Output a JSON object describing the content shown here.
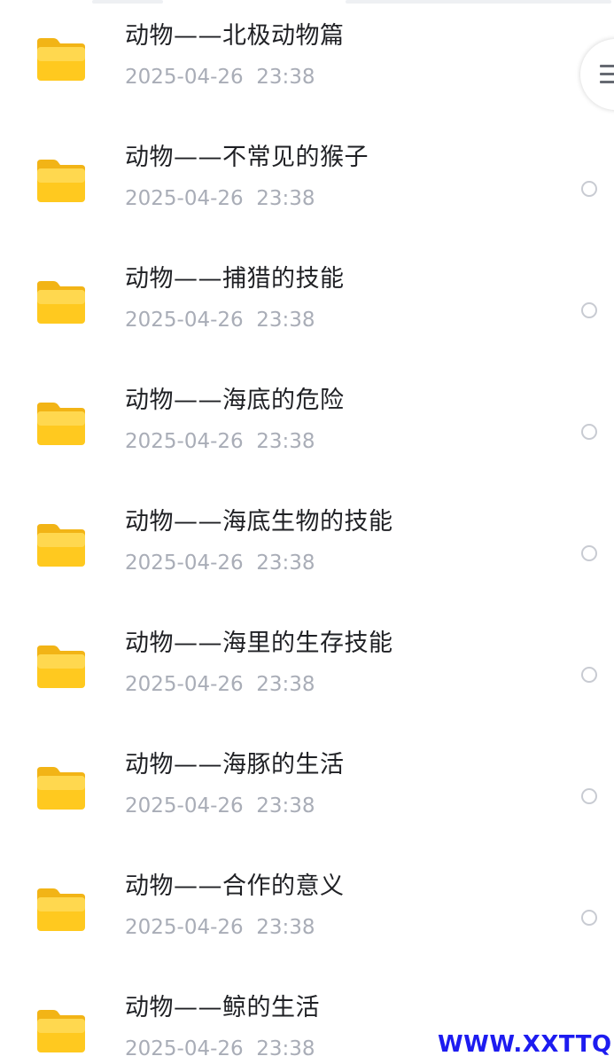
{
  "files": [
    {
      "name": "动物——北极动物篇",
      "date": "2025-04-26  23:38"
    },
    {
      "name": "动物——不常见的猴子",
      "date": "2025-04-26  23:38"
    },
    {
      "name": "动物——捕猎的技能",
      "date": "2025-04-26  23:38"
    },
    {
      "name": "动物——海底的危险",
      "date": "2025-04-26  23:38"
    },
    {
      "name": "动物——海底生物的技能",
      "date": "2025-04-26  23:38"
    },
    {
      "name": "动物——海里的生存技能",
      "date": "2025-04-26  23:38"
    },
    {
      "name": "动物——海豚的生活",
      "date": "2025-04-26  23:38"
    },
    {
      "name": "动物——合作的意义",
      "date": "2025-04-26  23:38"
    },
    {
      "name": "动物——鲸的生活",
      "date": "2025-04-26  23:38"
    }
  ],
  "icons": {
    "folder": "folder-icon",
    "select": "radio-circle-icon",
    "menu": "menu-icon"
  },
  "colors": {
    "folder_top": "#ffd84f",
    "folder_bottom": "#ffc21a",
    "name_text": "#1f2024",
    "date_text": "#a9adb7",
    "watermark": "#1d1cf0"
  },
  "watermark": "WWW.XXTTQ.COM"
}
